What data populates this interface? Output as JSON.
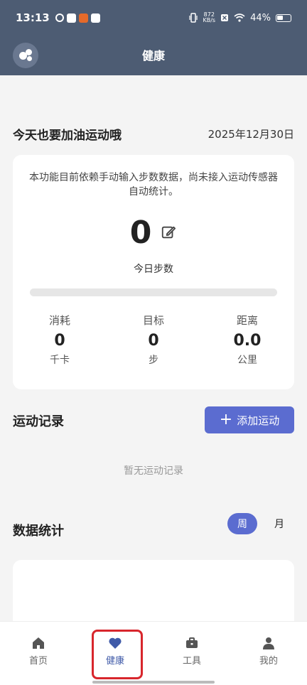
{
  "status_bar": {
    "time": "13:13",
    "net_speed_value": "872",
    "net_speed_unit": "KB/s",
    "battery": "44%"
  },
  "nav": {
    "title": "健康"
  },
  "greeting": {
    "text": "今天也要加油运动哦",
    "date": "2025年12月30日"
  },
  "step_card": {
    "notice": "本功能目前依赖手动输入步数数据，尚未接入运动传感器自动统计。",
    "steps": "0",
    "steps_label": "今日步数",
    "progress_fraction": 0,
    "stats": [
      {
        "label": "消耗",
        "value": "0",
        "unit": "千卡"
      },
      {
        "label": "目标",
        "value": "0",
        "unit": "步"
      },
      {
        "label": "距离",
        "value": "0.0",
        "unit": "公里"
      }
    ]
  },
  "records": {
    "title": "运动记录",
    "add_button": "添加运动",
    "empty_text": "暂无运动记录"
  },
  "statistics": {
    "title": "数据统计",
    "week_label": "周",
    "month_label": "月"
  },
  "tabbar": {
    "items": [
      {
        "label": "首页",
        "icon": "home-icon"
      },
      {
        "label": "健康",
        "icon": "heart-icon"
      },
      {
        "label": "工具",
        "icon": "toolbox-icon"
      },
      {
        "label": "我的",
        "icon": "user-icon"
      }
    ],
    "active_index": 1
  },
  "colors": {
    "header": "#4d5c73",
    "accent": "#5b6cd0",
    "highlight": "#d8262c"
  }
}
